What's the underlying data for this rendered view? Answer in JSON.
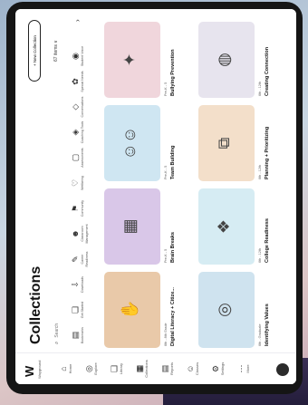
{
  "rail": {
    "logo": "W",
    "logo_sub": "Wayground",
    "items": [
      {
        "label": "Home",
        "icon": "home-icon",
        "glyph": "⌂"
      },
      {
        "label": "Explore",
        "icon": "compass-icon",
        "glyph": "◎"
      },
      {
        "label": "Library",
        "icon": "book-icon",
        "glyph": "❑"
      },
      {
        "label": "Collections",
        "icon": "collection-icon",
        "glyph": "▦"
      },
      {
        "label": "Reports",
        "icon": "chart-icon",
        "glyph": "▤"
      },
      {
        "label": "Classes",
        "icon": "users-icon",
        "glyph": "☺"
      },
      {
        "label": "Settings",
        "icon": "gear-icon",
        "glyph": "⚙"
      },
      {
        "label": "More",
        "icon": "more-icon",
        "glyph": "⋯"
      }
    ]
  },
  "header": {
    "title": "Collections",
    "new_button": "+ New Collection",
    "search_placeholder": "Search",
    "sort_label": "67 items ∨"
  },
  "categories": [
    {
      "label": "Bookmarks",
      "glyph": "▤"
    },
    {
      "label": "Get Started",
      "glyph": "❏"
    },
    {
      "label": "Downloads",
      "glyph": "⇩"
    },
    {
      "label": "Career Readiness",
      "glyph": "✎"
    },
    {
      "label": "Classroom Management",
      "glyph": "☻"
    },
    {
      "label": "Community",
      "glyph": "⚑"
    },
    {
      "label": "Wellbeing",
      "glyph": "♡"
    },
    {
      "label": "Assessments",
      "glyph": "▢"
    },
    {
      "label": "Coaching Tools",
      "glyph": "◈"
    },
    {
      "label": "Conversations",
      "glyph": "◇"
    },
    {
      "label": "Special Needs",
      "glyph": "✿"
    },
    {
      "label": "Student Voice",
      "glyph": "◉"
    }
  ],
  "cards": [
    {
      "meta": "6th - 8th Grade",
      "name": "Digital Literacy + Citize...",
      "glyph": "✋"
    },
    {
      "meta": "Pre-K - 5",
      "name": "Brain Breaks",
      "glyph": "▦"
    },
    {
      "meta": "Pre-K - 5",
      "name": "Team Building",
      "glyph": "☺☺"
    },
    {
      "meta": "Pre-K - 5",
      "name": "Bullying Prevention",
      "glyph": "✦"
    },
    {
      "meta": "6th - Graduate",
      "name": "Identifying Values",
      "glyph": "◎"
    },
    {
      "meta": "6th - 12th",
      "name": "College Readiness",
      "glyph": "❖"
    },
    {
      "meta": "6th - 12th",
      "name": "Planning + Prioritizing",
      "glyph": "⧉"
    },
    {
      "meta": "6th - 12th",
      "name": "Creating Connection",
      "glyph": "◍"
    }
  ],
  "colors": {
    "accent": "#111111",
    "thumbs": [
      "#e9c9a9",
      "#d9c7e8",
      "#cfe6f2",
      "#f0d6dc",
      "#cfe3ef",
      "#d6ecf3",
      "#f3dfca",
      "#e7e4ee"
    ]
  }
}
